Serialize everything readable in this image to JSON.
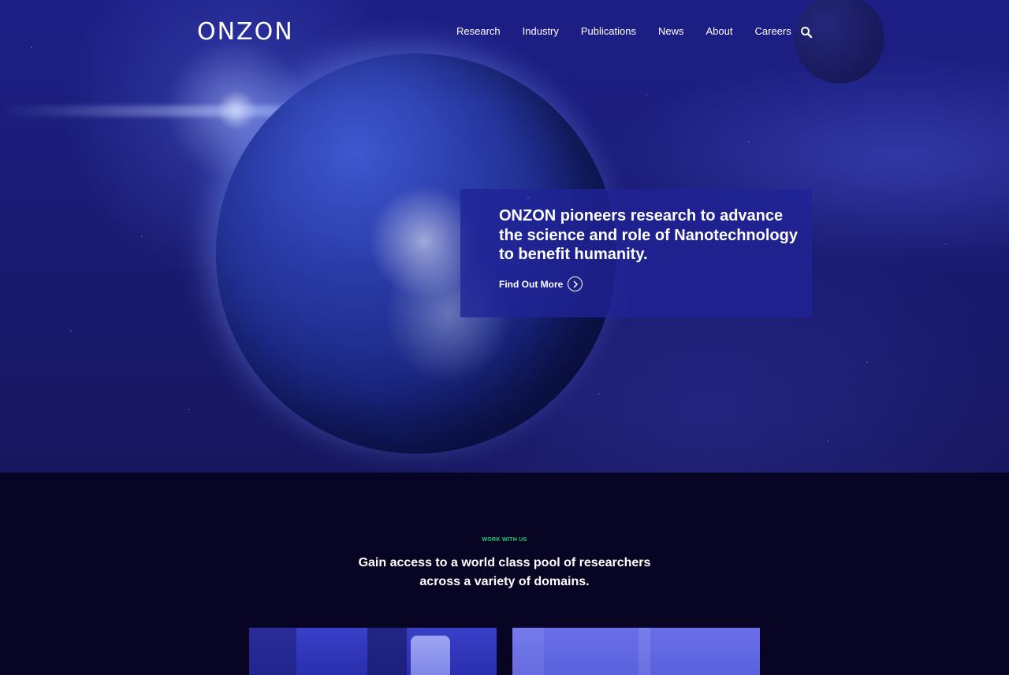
{
  "brand": {
    "logo_text": "ONZON"
  },
  "nav": {
    "items": [
      {
        "label": "Research"
      },
      {
        "label": "Industry"
      },
      {
        "label": "Publications"
      },
      {
        "label": "News"
      },
      {
        "label": "About"
      },
      {
        "label": "Careers"
      }
    ],
    "search_icon": "search-icon"
  },
  "hero": {
    "headline": "ONZON pioneers research to advance the science and role of Nanotechnology to benefit humanity.",
    "cta_label": "Find Out More",
    "cta_icon": "chevron-right-circle-icon"
  },
  "work_section": {
    "eyebrow": "WORK WITH US",
    "headline_line1": "Gain access to a world class pool of researchers",
    "headline_line2": "across a variety of domains."
  },
  "colors": {
    "accent_green": "#2ecc71",
    "hero_blue": "#1d1f86",
    "section_bg": "#080524",
    "cta_box": "#20229a"
  }
}
